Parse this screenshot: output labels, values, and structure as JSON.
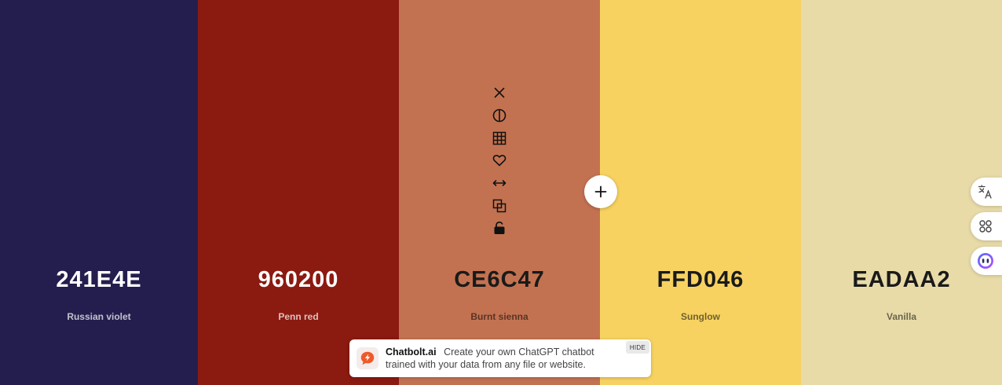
{
  "palette": [
    {
      "hex": "241E4E",
      "name": "Russian violet",
      "color": "#241E4E"
    },
    {
      "hex": "960200",
      "name": "Penn red",
      "color": "#8B1A10"
    },
    {
      "hex": "CE6C47",
      "name": "Burnt sienna",
      "color": "#C37251"
    },
    {
      "hex": "FFD046",
      "name": "Sunglow",
      "color": "#F7D261"
    },
    {
      "hex": "EADAA2",
      "name": "Vanilla",
      "color": "#E8DBA8"
    }
  ],
  "swatch_tools": [
    "close-icon",
    "contrast-icon",
    "grid-icon",
    "heart-icon",
    "drag-icon",
    "copy-icon",
    "lock-icon"
  ],
  "side_widgets": [
    "translate-icon",
    "apps-icon",
    "assistant-icon"
  ],
  "ad": {
    "brand": "Chatbolt.ai",
    "text_line1": "Create your own ChatGPT chatbot",
    "text_line2": "trained with your data from any file or website.",
    "hide_label": "HIDE"
  }
}
